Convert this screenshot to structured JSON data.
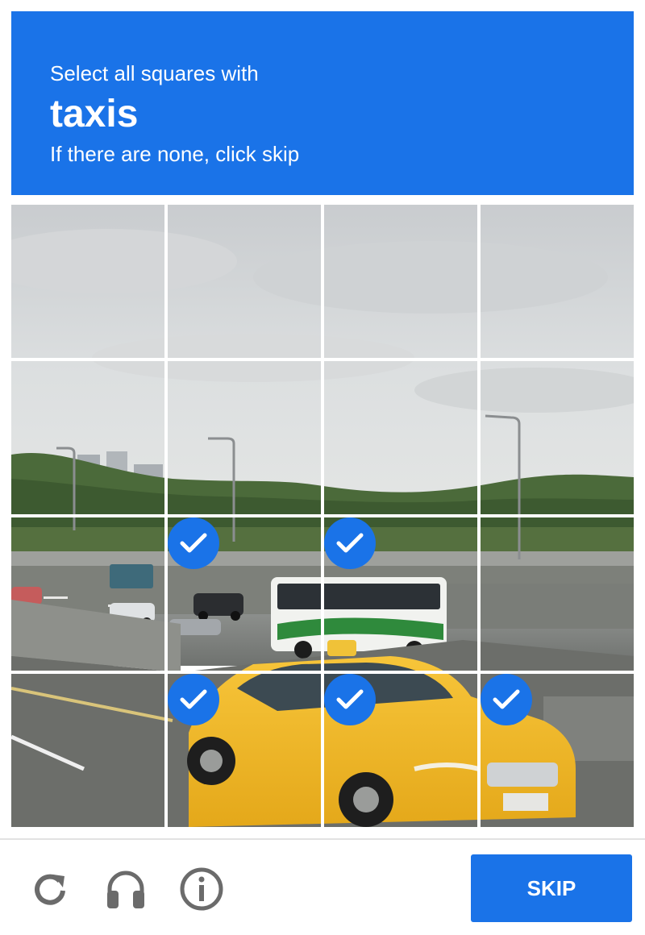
{
  "header": {
    "line1": "Select all squares with",
    "keyword": "taxis",
    "line3": "If there are none, click skip"
  },
  "grid": {
    "rows": 4,
    "columns": 4,
    "tiles": [
      {
        "row": 1,
        "col": 1,
        "selected": false
      },
      {
        "row": 1,
        "col": 2,
        "selected": false
      },
      {
        "row": 1,
        "col": 3,
        "selected": false
      },
      {
        "row": 1,
        "col": 4,
        "selected": false
      },
      {
        "row": 2,
        "col": 1,
        "selected": false
      },
      {
        "row": 2,
        "col": 2,
        "selected": false
      },
      {
        "row": 2,
        "col": 3,
        "selected": false
      },
      {
        "row": 2,
        "col": 4,
        "selected": false
      },
      {
        "row": 3,
        "col": 1,
        "selected": false
      },
      {
        "row": 3,
        "col": 2,
        "selected": true
      },
      {
        "row": 3,
        "col": 3,
        "selected": true
      },
      {
        "row": 3,
        "col": 4,
        "selected": false
      },
      {
        "row": 4,
        "col": 1,
        "selected": false
      },
      {
        "row": 4,
        "col": 2,
        "selected": true
      },
      {
        "row": 4,
        "col": 3,
        "selected": true
      },
      {
        "row": 4,
        "col": 4,
        "selected": true
      }
    ]
  },
  "footer": {
    "icons": [
      "reload-icon",
      "audio-headphones-icon",
      "info-icon"
    ],
    "skip_label": "SKIP"
  },
  "colors": {
    "accent": "#1a73e8",
    "selected_check": "#1a73e8"
  }
}
